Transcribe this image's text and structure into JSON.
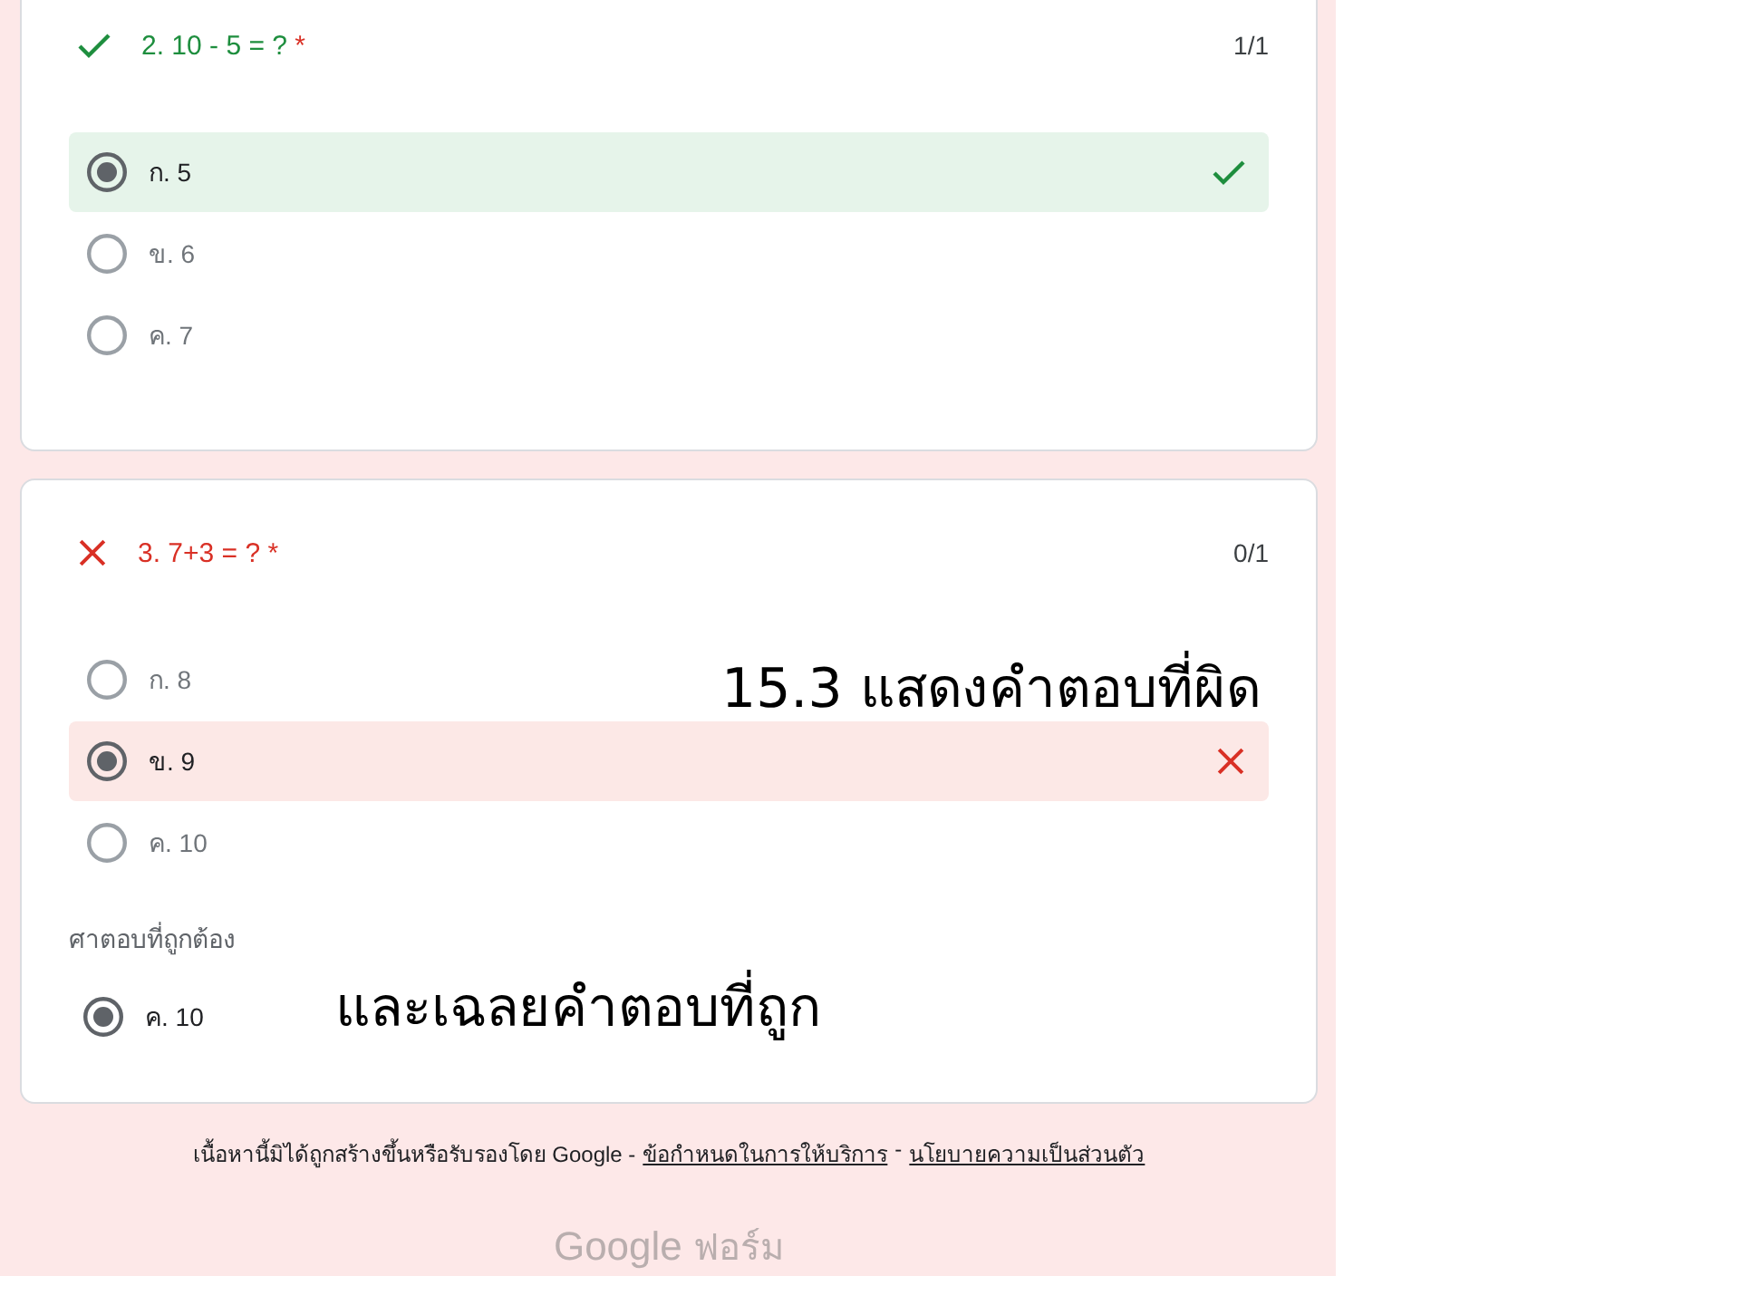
{
  "questions": [
    {
      "title": "2. 10 - 5 = ?",
      "required_mark": "*",
      "correct": true,
      "score": "1/1",
      "options": [
        {
          "label": "ก. 5",
          "selected": true
        },
        {
          "label": "ข. 6",
          "selected": false
        },
        {
          "label": "ค. 7",
          "selected": false
        }
      ]
    },
    {
      "title": "3. 7+3 = ?",
      "required_mark": "*",
      "correct": false,
      "score": "0/1",
      "options": [
        {
          "label": "ก. 8",
          "selected": false
        },
        {
          "label": "ข. 9",
          "selected": true
        },
        {
          "label": "ค. 10",
          "selected": false
        }
      ],
      "correct_answer": {
        "label": "ศาตอบที่ถูกต้อง",
        "option": {
          "label": "ค. 10",
          "selected": true
        }
      }
    }
  ],
  "annotations": [
    "15.3 แสดงคำตอบที่ผิด",
    "และเฉลยคำตอบที่ถูก"
  ],
  "footer": {
    "text": "เนื้อหานี้มิได้ถูกสร้างขึ้นหรือรับรองโดย Google -",
    "links": [
      "ข้อกำหนดในการให้บริการ",
      "นโยบายความเป็นส่วนตัว"
    ],
    "separator": "-",
    "logo_brand": "Google",
    "logo_product": "ฟอร์ม"
  }
}
